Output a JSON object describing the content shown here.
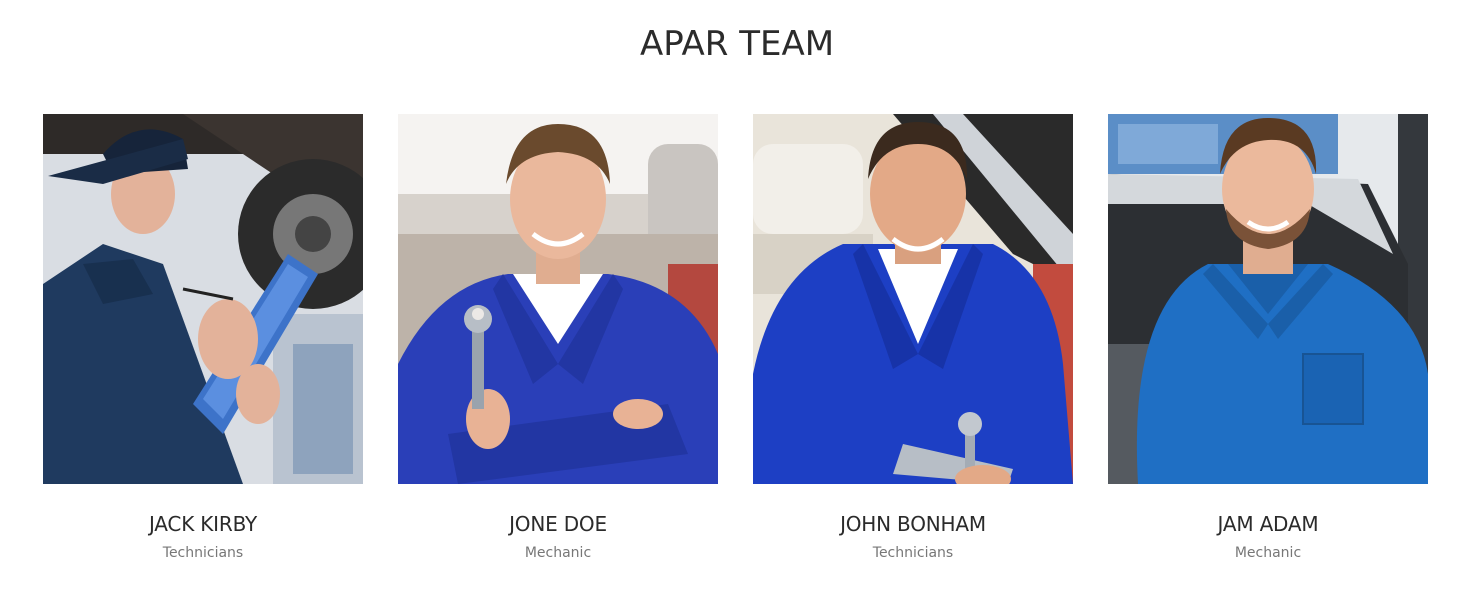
{
  "section": {
    "title": "APAR TEAM"
  },
  "team": [
    {
      "name": "JACK KIRBY",
      "role": "Technicians",
      "photo_icon": "mechanic-with-clipboard-photo"
    },
    {
      "name": "JONE DOE",
      "role": "Mechanic",
      "photo_icon": "mechanic-with-wrench-photo"
    },
    {
      "name": "JOHN BONHAM",
      "role": "Technicians",
      "photo_icon": "mechanic-under-hood-photo"
    },
    {
      "name": "JAM ADAM",
      "role": "Mechanic",
      "photo_icon": "mechanic-smiling-photo"
    }
  ],
  "colors": {
    "heading": "#2b2b2b",
    "subtitle": "#777777",
    "uniform_dark": "#1f3a5f",
    "uniform_royal": "#2a3fb8",
    "uniform_blue": "#1f6fc4"
  }
}
